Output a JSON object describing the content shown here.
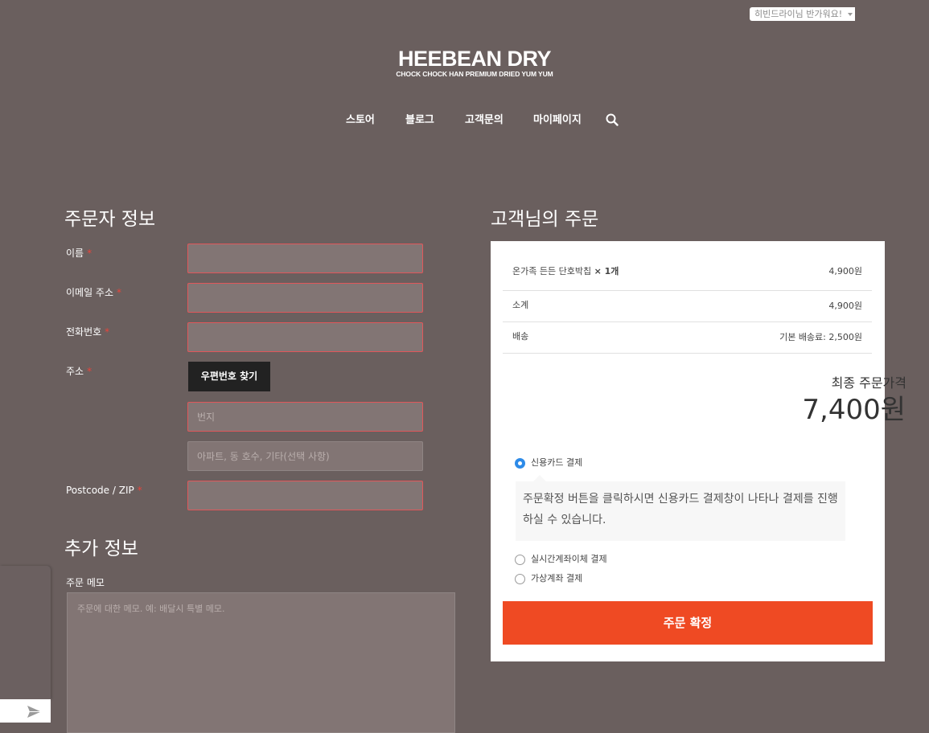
{
  "header": {
    "greeting": "히빈드라이님 반가워요!",
    "logo_main": "HEEBEAN DRY",
    "logo_sub": "CHOCK CHOCK HAN PREMIUM DRIED YUM YUM"
  },
  "nav": {
    "items": [
      {
        "label": "스토어"
      },
      {
        "label": "블로그"
      },
      {
        "label": "고객문의"
      },
      {
        "label": "마이페이지"
      }
    ],
    "search_icon": "search-icon"
  },
  "billing": {
    "title": "주문자 정보",
    "required_mark": "*",
    "name_label": "이름",
    "email_label": "이메일 주소",
    "phone_label": "전화번호",
    "address_label": "주소",
    "zip_button": "우편번호 찾기",
    "address1_placeholder": "번지",
    "address2_placeholder": "아파트, 동 호수, 기타(선택 사항)",
    "postcode_label": "Postcode / ZIP"
  },
  "additional": {
    "title": "추가 정보",
    "memo_label": "주문 메모",
    "memo_placeholder": "주문에 대한 메모. 예: 배달시 특별 메모."
  },
  "order": {
    "title": "고객님의 주문",
    "item_name": "온가족 든든 단호박칩",
    "item_qty": "× 1개",
    "item_price": "4,900원",
    "subtotal_label": "소계",
    "subtotal_value": "4,900원",
    "shipping_label": "배송",
    "shipping_value": "기본 배송료: 2,500원",
    "total_label": "최종 주문가격",
    "total_value": "7,400원",
    "payment": {
      "card_label": "신용카드 결제",
      "card_desc": "주문확정 버튼을 클릭하시면 신용카드 결제창이 나타나 결제를 진행하실 수 있습니다.",
      "transfer_label": "실시간계좌이체 결제",
      "virtual_label": "가상계좌 결제",
      "selected": "card"
    },
    "confirm_button": "주문 확정"
  },
  "colors": {
    "background": "#6a5f5e",
    "accent": "#ef4a23",
    "required": "#e8453c",
    "radio_selected": "#2d8be8"
  }
}
